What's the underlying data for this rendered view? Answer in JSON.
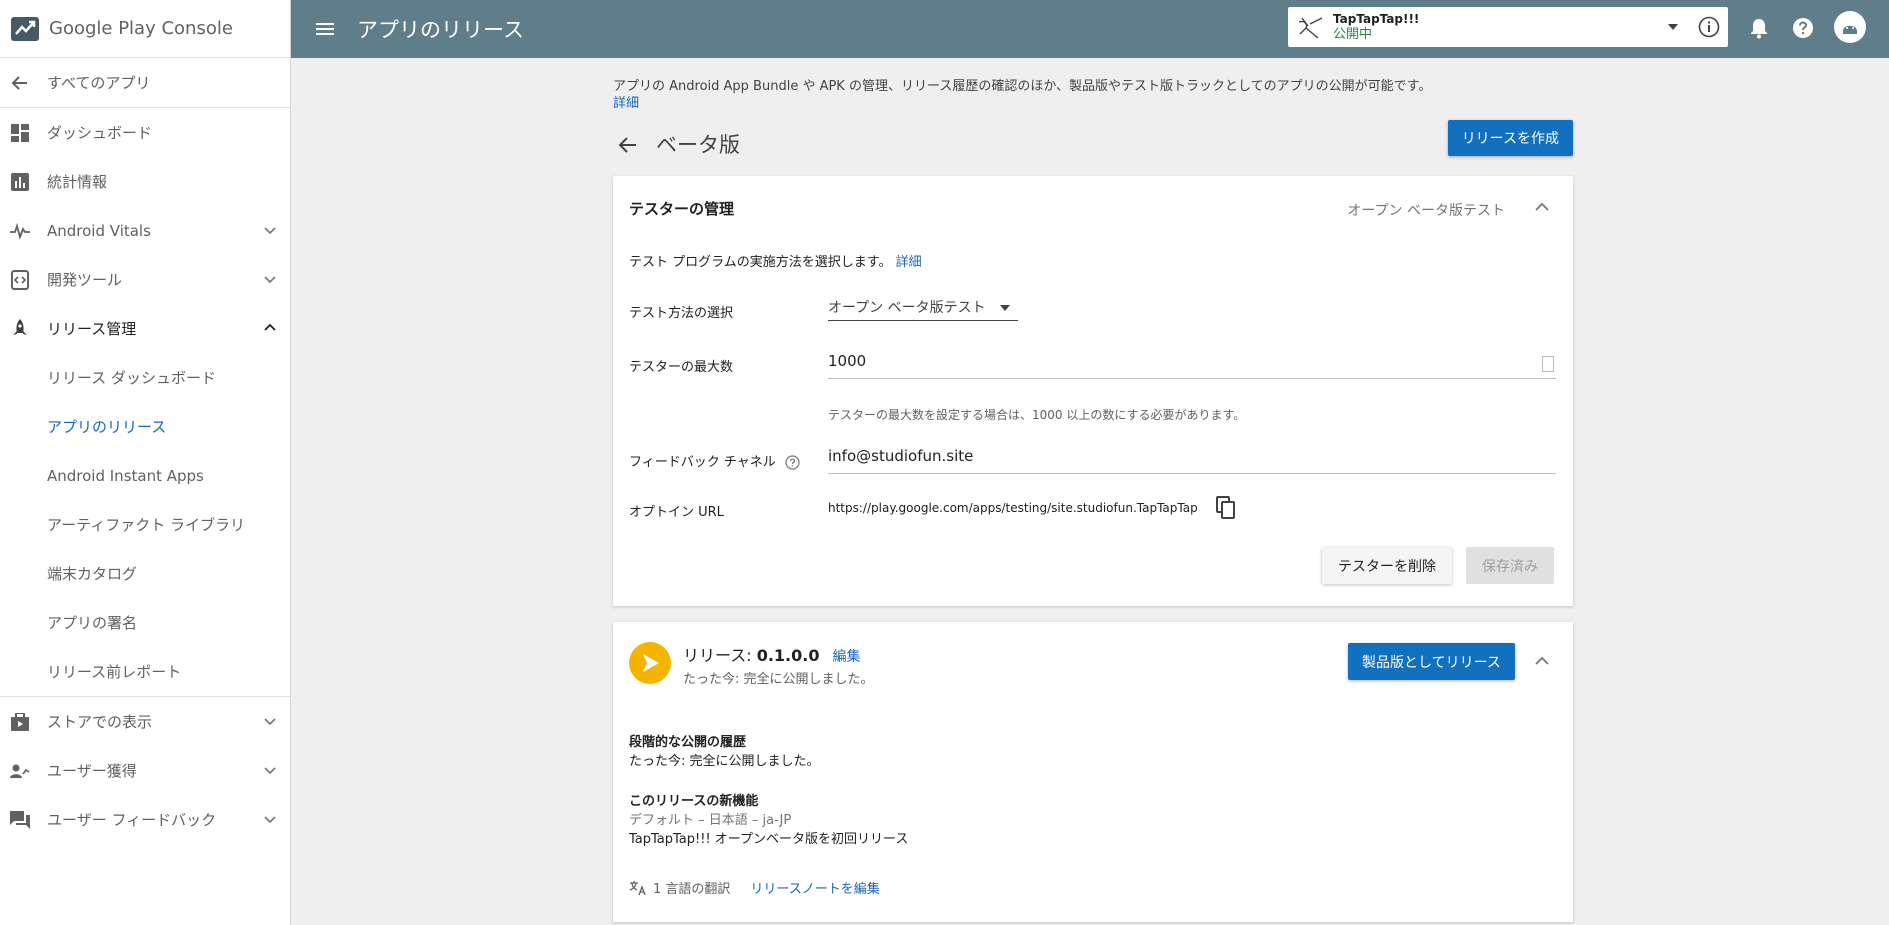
{
  "sidebar": {
    "logo_text": "Google Play Console",
    "back_label": "すべてのアプリ",
    "items": [
      {
        "label": "ダッシュボード",
        "icon": "dashboard-icon"
      },
      {
        "label": "統計情報",
        "icon": "stats-icon"
      },
      {
        "label": "Android Vitals",
        "icon": "vitals-icon"
      },
      {
        "label": "開発ツール",
        "icon": "devtools-icon"
      },
      {
        "label": "リリース管理",
        "icon": "rocket-icon"
      }
    ],
    "release_subitems": [
      "リリース ダッシュボード",
      "アプリのリリース",
      "Android Instant Apps",
      "アーティファクト ライブラリ",
      "端末カタログ",
      "アプリの署名",
      "リリース前レポート"
    ],
    "bottom_items": [
      {
        "label": "ストアでの表示",
        "icon": "store-icon"
      },
      {
        "label": "ユーザー獲得",
        "icon": "user-acquisition-icon"
      },
      {
        "label": "ユーザー フィードバック",
        "icon": "feedback-icon"
      }
    ]
  },
  "topbar": {
    "title": "アプリのリリース",
    "app_name": "TapTapTap!!!",
    "app_status": "公開中"
  },
  "main": {
    "intro": "アプリの Android App Bundle や APK の管理、リリース履歴の確認のほか、製品版やテスト版トラックとしてのアプリの公開が可能です。",
    "intro_link": "詳細",
    "page_title": "ベータ版",
    "create_release": "リリースを作成"
  },
  "testers": {
    "title": "テスターの管理",
    "meta": "オープン ベータ版テスト",
    "desc": "テスト プログラムの実施方法を選択します。",
    "desc_link": "詳細",
    "method_label": "テスト方法の選択",
    "method_value": "オープン ベータ版テスト",
    "max_label": "テスターの最大数",
    "max_value": "1000",
    "max_hint": "テスターの最大数を設定する場合は、1000 以上の数にする必要があります。",
    "feedback_label": "フィードバック チャネル",
    "feedback_value": "info@studiofun.site",
    "optin_label": "オプトイン URL",
    "optin_value": "https://play.google.com/apps/testing/site.studiofun.TapTapTap",
    "delete_button": "テスターを削除",
    "saved_button": "保存済み"
  },
  "release": {
    "title_prefix": "リリース: ",
    "version": "0.1.0.0",
    "edit_link": "編集",
    "subtitle": "たった今: 完全に公開しました。",
    "promote_button": "製品版としてリリース",
    "history_title": "段階的な公開の履歴",
    "history_text": "たった今: 完全に公開しました。",
    "whatsnew_title": "このリリースの新機能",
    "whatsnew_lang": "デフォルト – 日本語 – ja-JP",
    "whatsnew_text": "TapTapTap!!! オープンベータ版を初回リリース",
    "translations": "1 言語の翻訳",
    "edit_notes_link": "リリースノートを編集"
  }
}
